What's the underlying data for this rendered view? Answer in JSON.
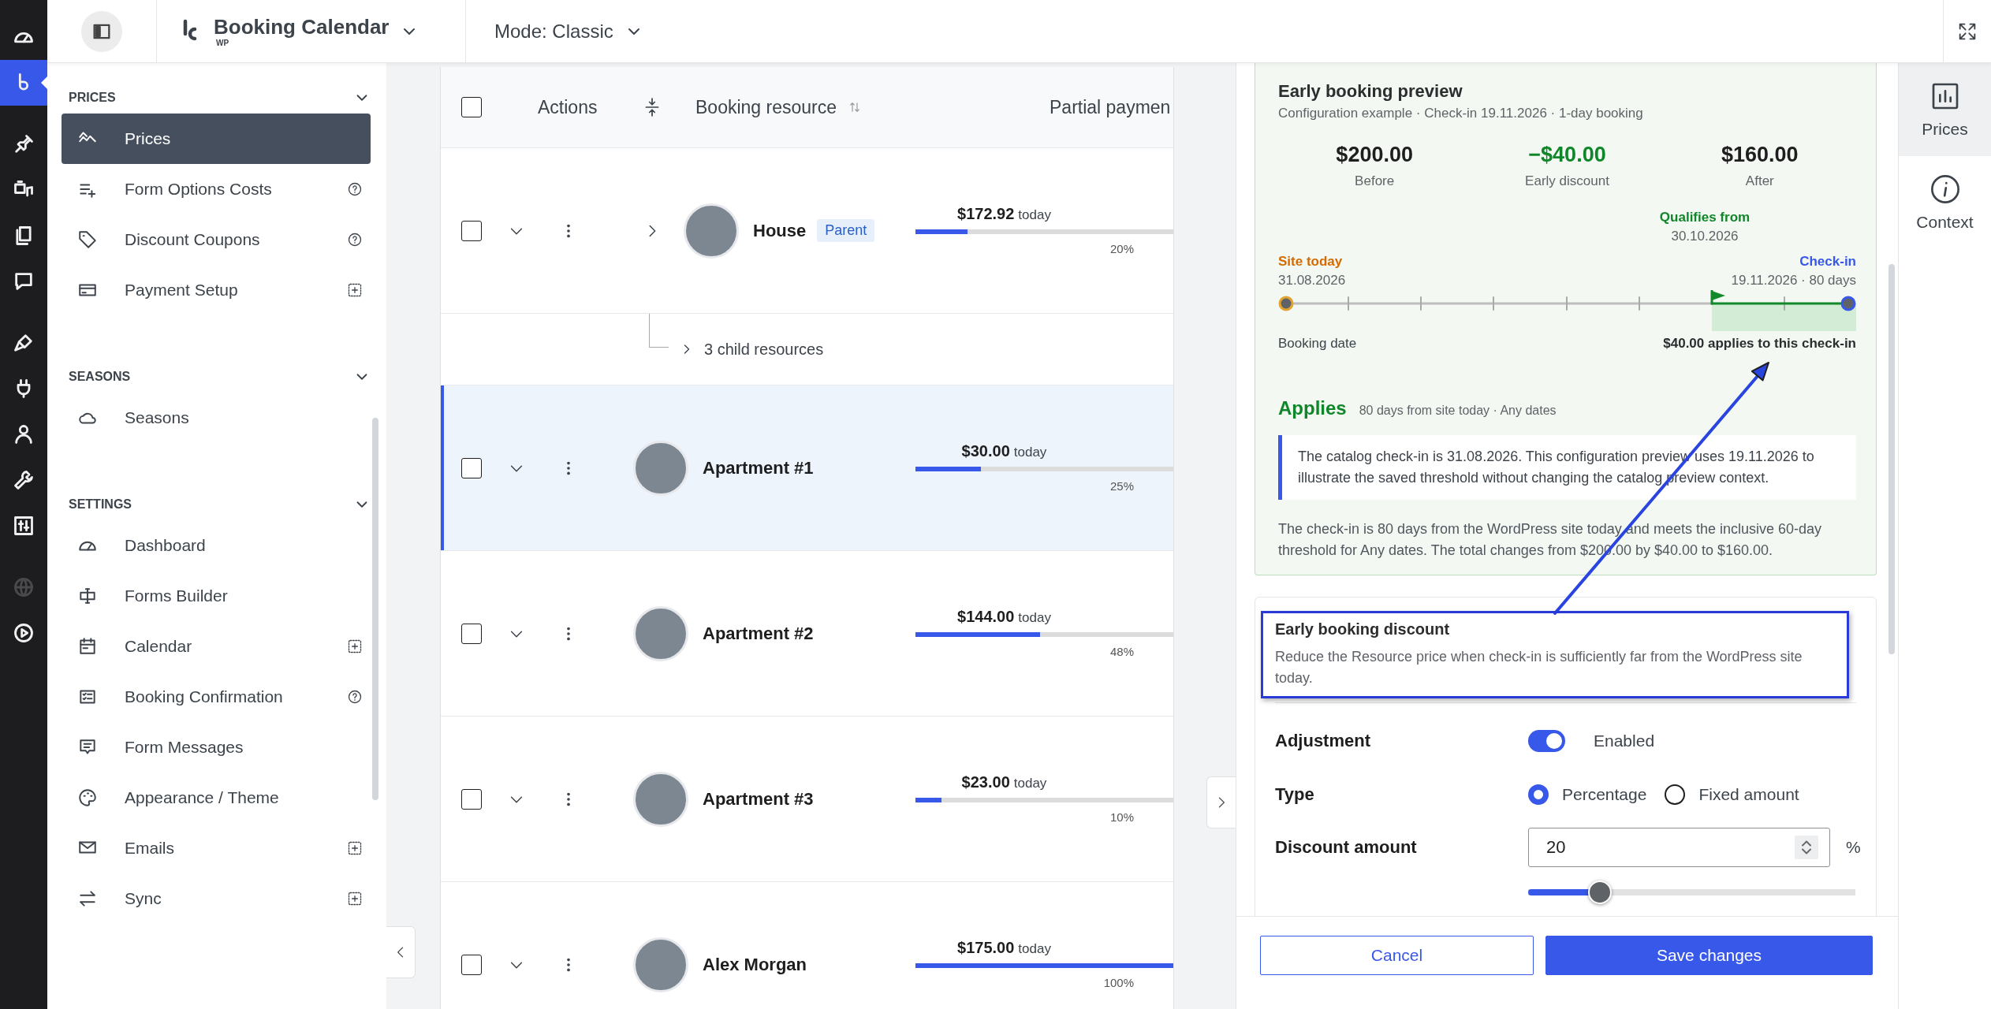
{
  "admin_menu": [
    {
      "selected": false,
      "disabled": false
    },
    {
      "selected": true,
      "disabled": false
    },
    {
      "selected": false,
      "disabled": false
    },
    {
      "selected": false,
      "disabled": false
    },
    {
      "selected": false,
      "disabled": false
    },
    {
      "selected": false,
      "disabled": false
    },
    {
      "selected": false,
      "disabled": false
    },
    {
      "selected": false,
      "disabled": false
    },
    {
      "selected": false,
      "disabled": false
    },
    {
      "selected": false,
      "disabled": false
    },
    {
      "selected": false,
      "disabled": false
    },
    {
      "selected": false,
      "disabled": true
    },
    {
      "selected": false,
      "disabled": false
    }
  ],
  "top_bar": {
    "title": "Booking Calendar",
    "edition": "WP",
    "mode": "Mode: Classic"
  },
  "nav": {
    "sections": [
      {
        "title": "PRICES",
        "expanded": true,
        "items": [
          {
            "label": "Prices",
            "selected": true
          },
          {
            "label": "Form Options Costs",
            "selected": false
          },
          {
            "label": "Discount Coupons",
            "selected": false
          },
          {
            "label": "Payment Setup",
            "selected": false
          }
        ]
      },
      {
        "title": "SEASONS",
        "expanded": true,
        "items": [
          {
            "label": "Seasons",
            "selected": false
          }
        ]
      },
      {
        "title": "SETTINGS",
        "expanded": true,
        "items": [
          {
            "label": "Dashboard",
            "selected": false
          },
          {
            "label": "Forms Builder",
            "selected": false
          },
          {
            "label": "Calendar",
            "selected": false
          },
          {
            "label": "Booking Confirmation",
            "selected": false
          },
          {
            "label": "Form Messages",
            "selected": false
          },
          {
            "label": "Appearance / Theme",
            "selected": false
          },
          {
            "label": "Emails",
            "selected": false
          },
          {
            "label": "Sync",
            "selected": false
          }
        ]
      }
    ]
  },
  "table": {
    "select_all_checked": false,
    "columns": [
      "Actions",
      "Booking resource",
      "Partial paymen"
    ],
    "rows": [
      {
        "kind": "parent",
        "name": "House",
        "tag": "Parent",
        "amount": "$172.92",
        "note": "today",
        "level": 0.2,
        "percent": "20%",
        "checked": false,
        "selected": false
      },
      {
        "kind": "children",
        "label": "3 child resources"
      },
      {
        "kind": "resource",
        "name": "Apartment #1",
        "amount": "$30.00",
        "note": "today",
        "level": 0.25,
        "percent": "25%",
        "checked": false,
        "selected": true
      },
      {
        "kind": "resource",
        "name": "Apartment #2",
        "amount": "$144.00",
        "note": "today",
        "level": 0.48,
        "percent": "48%",
        "checked": false,
        "selected": false
      },
      {
        "kind": "resource",
        "name": "Apartment #3",
        "amount": "$23.00",
        "note": "today",
        "level": 0.1,
        "percent": "10%",
        "checked": false,
        "selected": false
      },
      {
        "kind": "resource",
        "name": "Alex Morgan",
        "amount": "$175.00",
        "note": "today",
        "level": 1,
        "percent": "100%",
        "checked": false,
        "selected": false
      }
    ]
  },
  "panel": {
    "preview": {
      "title": "Early booking preview",
      "subtitle": "Configuration example · Check-in 19.11.2026 · 1-day booking",
      "stats": [
        {
          "value": "$200.00",
          "label": "Before",
          "kind": "neutral"
        },
        {
          "value": "−$40.00",
          "label": "Early discount",
          "kind": "discount"
        },
        {
          "value": "$160.00",
          "label": "After",
          "kind": "neutral"
        }
      ],
      "timeline": {
        "threshold_label": "Qualifies from",
        "threshold_date": "30.10.2026",
        "start_label": "Site today",
        "start_date": "31.08.2026",
        "end_label": "Check-in",
        "end_date": "19.11.2026 · 80 days",
        "axis_label": "Booking date",
        "result": "$40.00 applies to this check-in"
      },
      "status": "Applies",
      "status_detail": "80 days from site today · Any dates",
      "note": "The catalog check-in is 31.08.2026. This configuration preview uses 19.11.2026 to illustrate the saved threshold without changing the catalog preview context.",
      "summary": "The check-in is 80 days from the WordPress site today and meets the inclusive 60-day threshold for Any dates. The total changes from $200.00 by $40.00 to $160.00."
    },
    "discount": {
      "title": "Early booking discount",
      "description": "Reduce the Resource price when check-in is sufficiently far from the WordPress site today.",
      "adjustment": {
        "label": "Adjustment",
        "on": true,
        "state_text": "Enabled"
      },
      "type": {
        "label": "Type",
        "options": [
          {
            "label": "Percentage",
            "selected": true
          },
          {
            "label": "Fixed amount",
            "selected": false
          }
        ]
      },
      "amount": {
        "label": "Discount amount",
        "value": "20",
        "unit": "%",
        "level": 0.22
      }
    },
    "buttons": [
      {
        "label": "Cancel",
        "kind": "secondary"
      },
      {
        "label": "Save changes",
        "kind": "primary"
      }
    ]
  },
  "rail": [
    {
      "label": "Prices",
      "selected": true
    },
    {
      "label": "Context",
      "selected": false
    }
  ]
}
